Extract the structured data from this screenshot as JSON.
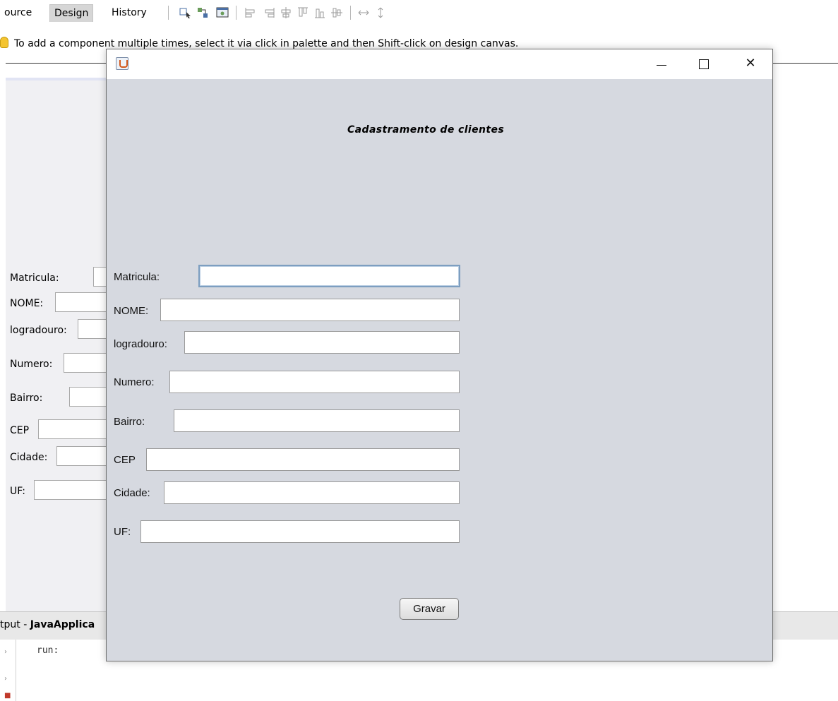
{
  "ide": {
    "tabs": [
      "ource",
      "Design",
      "History"
    ],
    "active_tab": "Design",
    "hint": "To add a component multiple times, select it via click in palette and then Shift-click on design canvas.",
    "design_labels": [
      "Matricula:",
      "NOME:",
      "logradouro:",
      "Numero:",
      "Bairro:",
      "CEP",
      "Cidade:",
      "UF:"
    ],
    "output_prefix": "tput - ",
    "output_project": "JavaApplica",
    "console_text": "run:"
  },
  "frame": {
    "heading": "Cadastramento de clientes",
    "window_controls": {
      "minimize": "minimize",
      "maximize": "maximize",
      "close": "✕"
    },
    "fields": [
      {
        "label": "Matricula:",
        "value": ""
      },
      {
        "label": "NOME:",
        "value": ""
      },
      {
        "label": "logradouro:",
        "value": ""
      },
      {
        "label": "Numero:",
        "value": ""
      },
      {
        "label": "Bairro:",
        "value": ""
      },
      {
        "label": "CEP",
        "value": ""
      },
      {
        "label": "Cidade:",
        "value": ""
      },
      {
        "label": "UF:",
        "value": ""
      }
    ],
    "button_label": "Gravar"
  },
  "colors": {
    "frame_background": "#d6d9e0",
    "focus_border": "#7d9ec0",
    "design_area": "#f0f0f3"
  },
  "icons": [
    "bulb-icon",
    "java-app-icon",
    "minimize-icon",
    "maximize-icon",
    "close-icon"
  ]
}
